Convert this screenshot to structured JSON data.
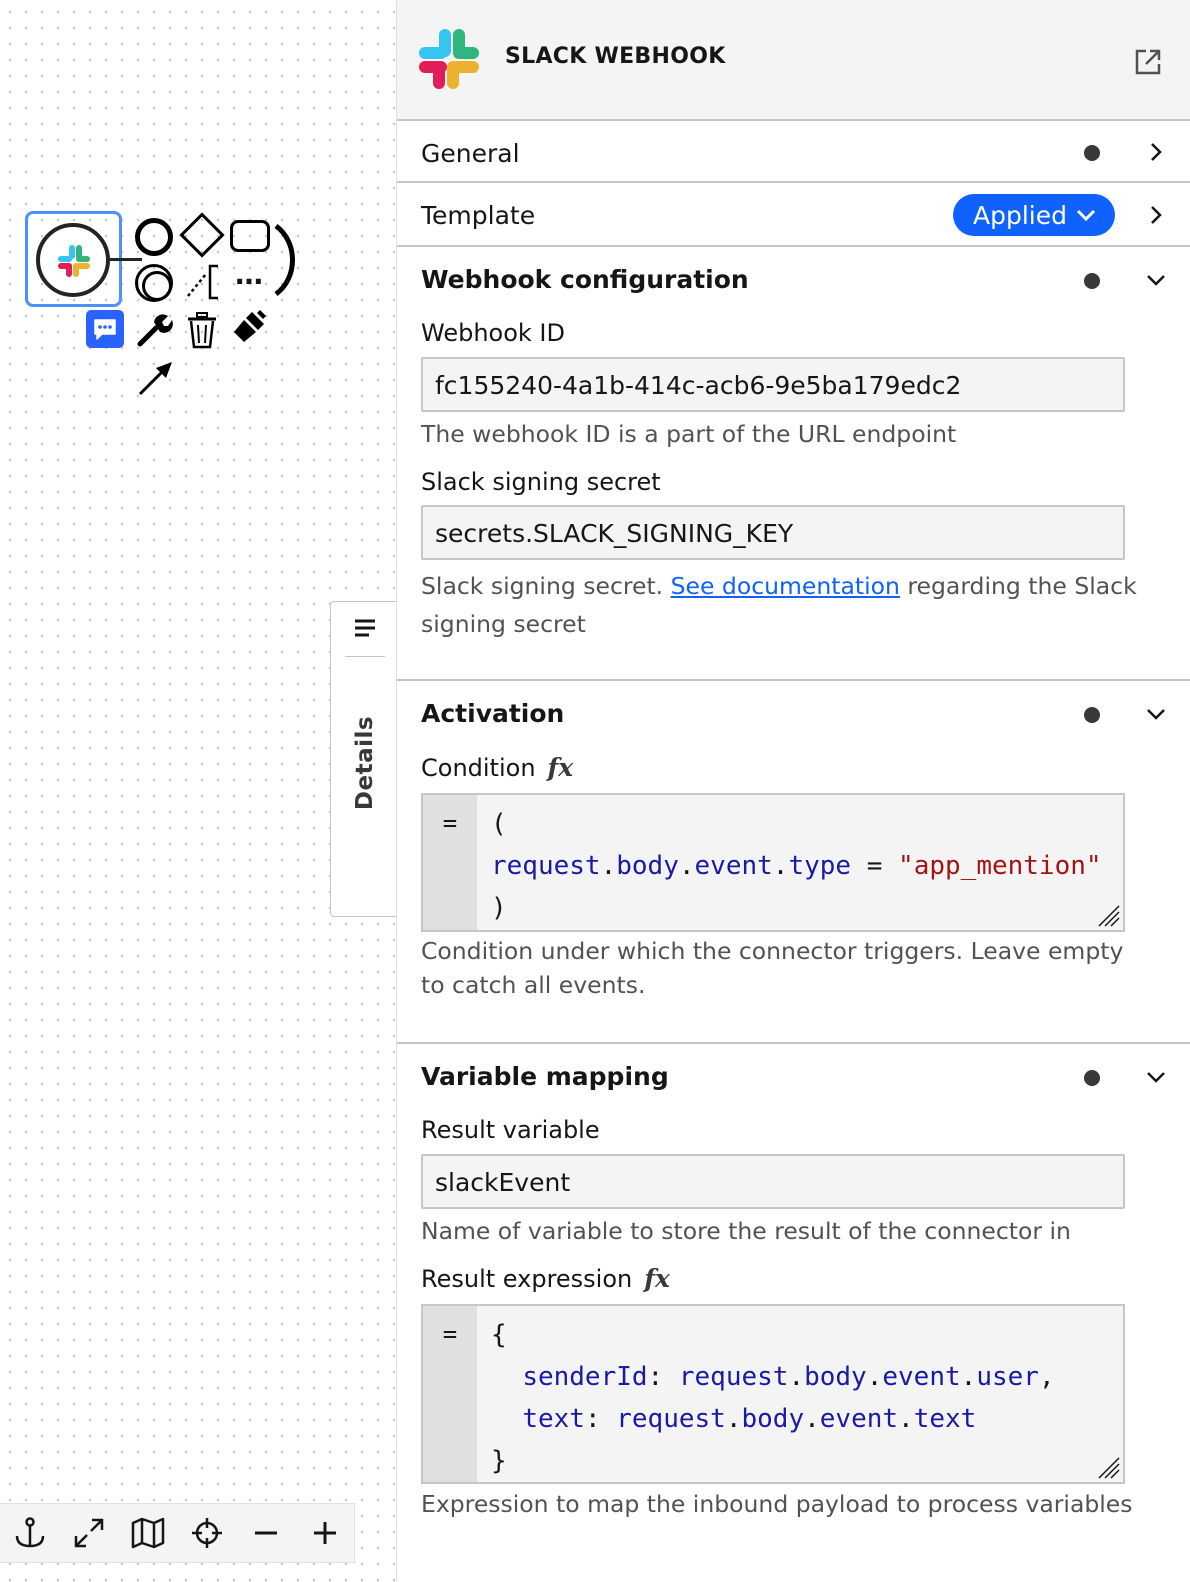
{
  "panel": {
    "title": "SLACK WEBHOOK",
    "groups": {
      "general": {
        "label": "General"
      },
      "template": {
        "label": "Template",
        "badge": "Applied"
      },
      "webhook": {
        "label": "Webhook configuration",
        "webhook_id_label": "Webhook ID",
        "webhook_id_value": "fc155240-4a1b-414c-acb6-9e5ba179edc2",
        "webhook_id_help": "The webhook ID is a part of the URL endpoint",
        "secret_label": "Slack signing secret",
        "secret_value": "secrets.SLACK_SIGNING_KEY",
        "secret_help_prefix": "Slack signing secret. ",
        "secret_help_link": "See documentation",
        "secret_help_suffix": " regarding the Slack signing secret"
      },
      "activation": {
        "label": "Activation",
        "condition_label": "Condition",
        "fx": "fx",
        "condition_prefix": "=",
        "condition_help": "Condition under which the connector triggers. Leave empty to catch all events."
      },
      "variable_mapping": {
        "label": "Variable mapping",
        "result_variable_label": "Result variable",
        "result_variable_value": "slackEvent",
        "result_variable_help": "Name of variable to store the result of the connector in",
        "result_expression_label": "Result expression",
        "fx": "fx",
        "expression_prefix": "=",
        "expression_help": "Expression to map the inbound payload to process variables"
      }
    }
  },
  "details_tab": {
    "label": "Details"
  },
  "colors": {
    "accent": "#0f62fe",
    "selection": "#4d90fe",
    "header_bg": "#f4f4f4"
  }
}
